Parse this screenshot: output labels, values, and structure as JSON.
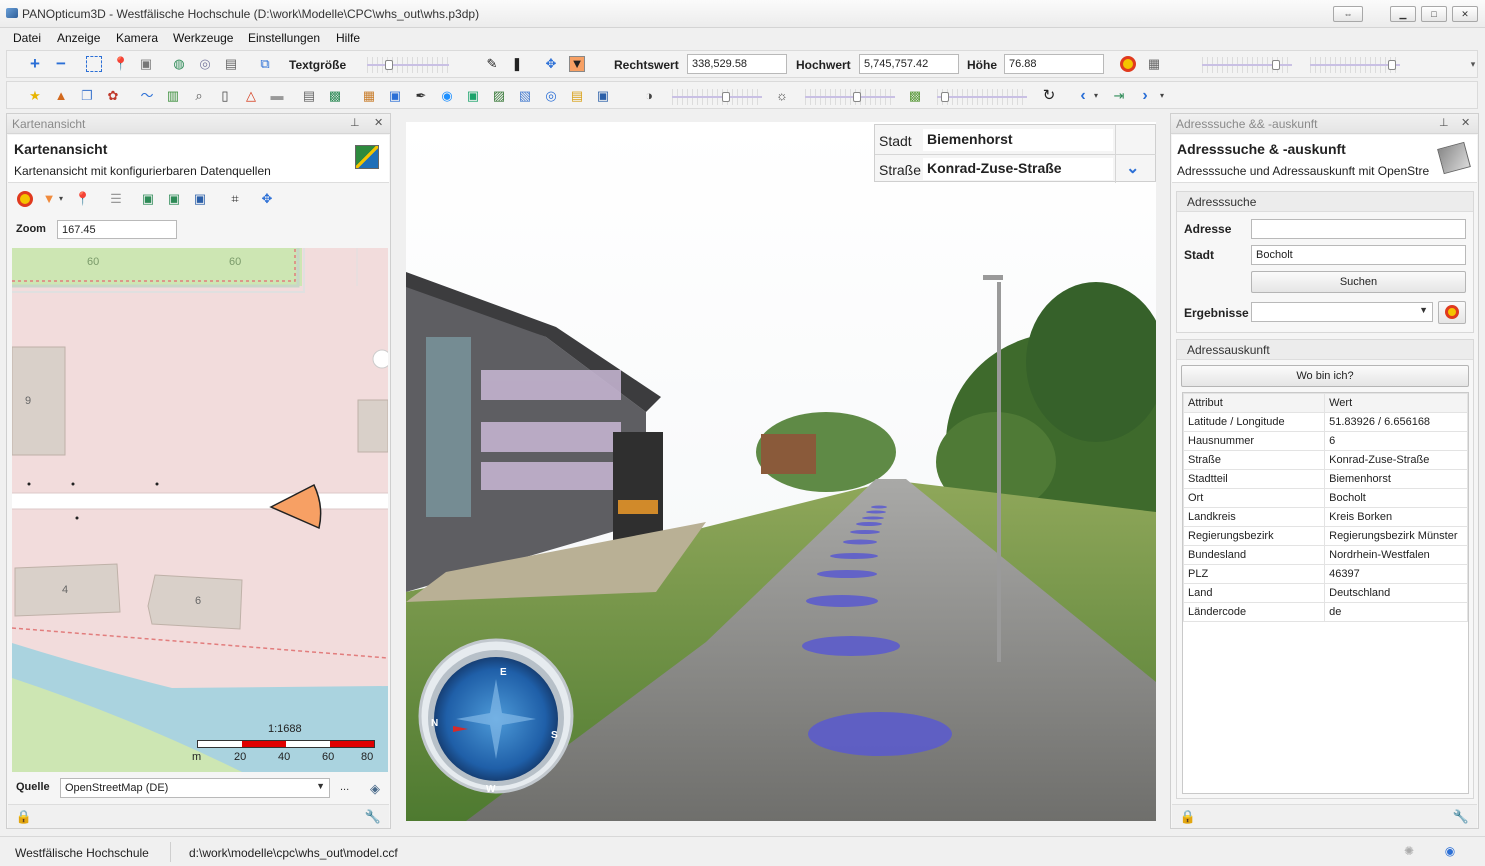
{
  "window": {
    "title": "PANOpticum3D - Westfälische Hochschule (D:\\work\\Modelle\\CPC\\whs_out\\whs.p3dp)"
  },
  "menu": [
    "Datei",
    "Anzeige",
    "Kamera",
    "Werkzeuge",
    "Einstellungen",
    "Hilfe"
  ],
  "toolbar": {
    "textgroesse_label": "Textgröße",
    "rechtswert_label": "Rechtswert",
    "rechtswert_value": "338,529.58",
    "hochwert_label": "Hochwert",
    "hochwert_value": "5,745,757.42",
    "hoehe_label": "Höhe",
    "hoehe_value": "76.88"
  },
  "map_panel": {
    "header": "Kartenansicht",
    "title": "Kartenansicht",
    "subtitle": "Kartenansicht mit konfigurierbaren Datenquellen",
    "zoom_label": "Zoom",
    "zoom_value": "167.45",
    "house_numbers": [
      "9",
      "4",
      "6"
    ],
    "street_numbers": [
      "60",
      "60"
    ],
    "scale_text": "1:1688",
    "scale_ticks": [
      "m",
      "20",
      "40",
      "60",
      "80"
    ],
    "source_label": "Quelle",
    "source_value": "OpenStreetMap (DE)",
    "source_more": "..."
  },
  "panorama": {
    "stadt_label": "Stadt",
    "stadt_value": "Biemenhorst",
    "strasse_label": "Straße",
    "strasse_value": "Konrad-Zuse-Straße",
    "compass": [
      "N",
      "E",
      "S",
      "W"
    ]
  },
  "address_panel": {
    "header": "Adresssuche && -auskunft",
    "title": "Adresssuche & -auskunft",
    "subtitle": "Adresssuche und Adressauskunft mit OpenStre",
    "search_group": "Adresssuche",
    "adresse_label": "Adresse",
    "adresse_value": "",
    "stadt_label": "Stadt",
    "stadt_value": "Bocholt",
    "search_button": "Suchen",
    "results_label": "Ergebnisse",
    "info_group": "Adressauskunft",
    "whereami_button": "Wo bin ich?",
    "table_header": [
      "Attribut",
      "Wert"
    ],
    "rows": [
      [
        "Latitude / Longitude",
        "51.83926 / 6.656168"
      ],
      [
        "Hausnummer",
        "6"
      ],
      [
        "Straße",
        "Konrad-Zuse-Straße"
      ],
      [
        "Stadtteil",
        "Biemenhorst"
      ],
      [
        "Ort",
        "Bocholt"
      ],
      [
        "Landkreis",
        "Kreis Borken"
      ],
      [
        "Regierungsbezirk",
        "Regierungsbezirk Münster"
      ],
      [
        "Bundesland",
        "Nordrhein-Westfalen"
      ],
      [
        "PLZ",
        "46397"
      ],
      [
        "Land",
        "Deutschland"
      ],
      [
        "Ländercode",
        "de"
      ]
    ]
  },
  "status": {
    "left": "Westfälische Hochschule",
    "path": "d:\\work\\modelle\\cpc\\whs_out\\model.ccf"
  },
  "colors": {
    "accent_blue": "#2b6fd6",
    "ellipse_blue": "#5a5ad0",
    "map_pink": "#f2dcdc",
    "map_green": "#cde6b3",
    "scale_red": "#e00000"
  }
}
